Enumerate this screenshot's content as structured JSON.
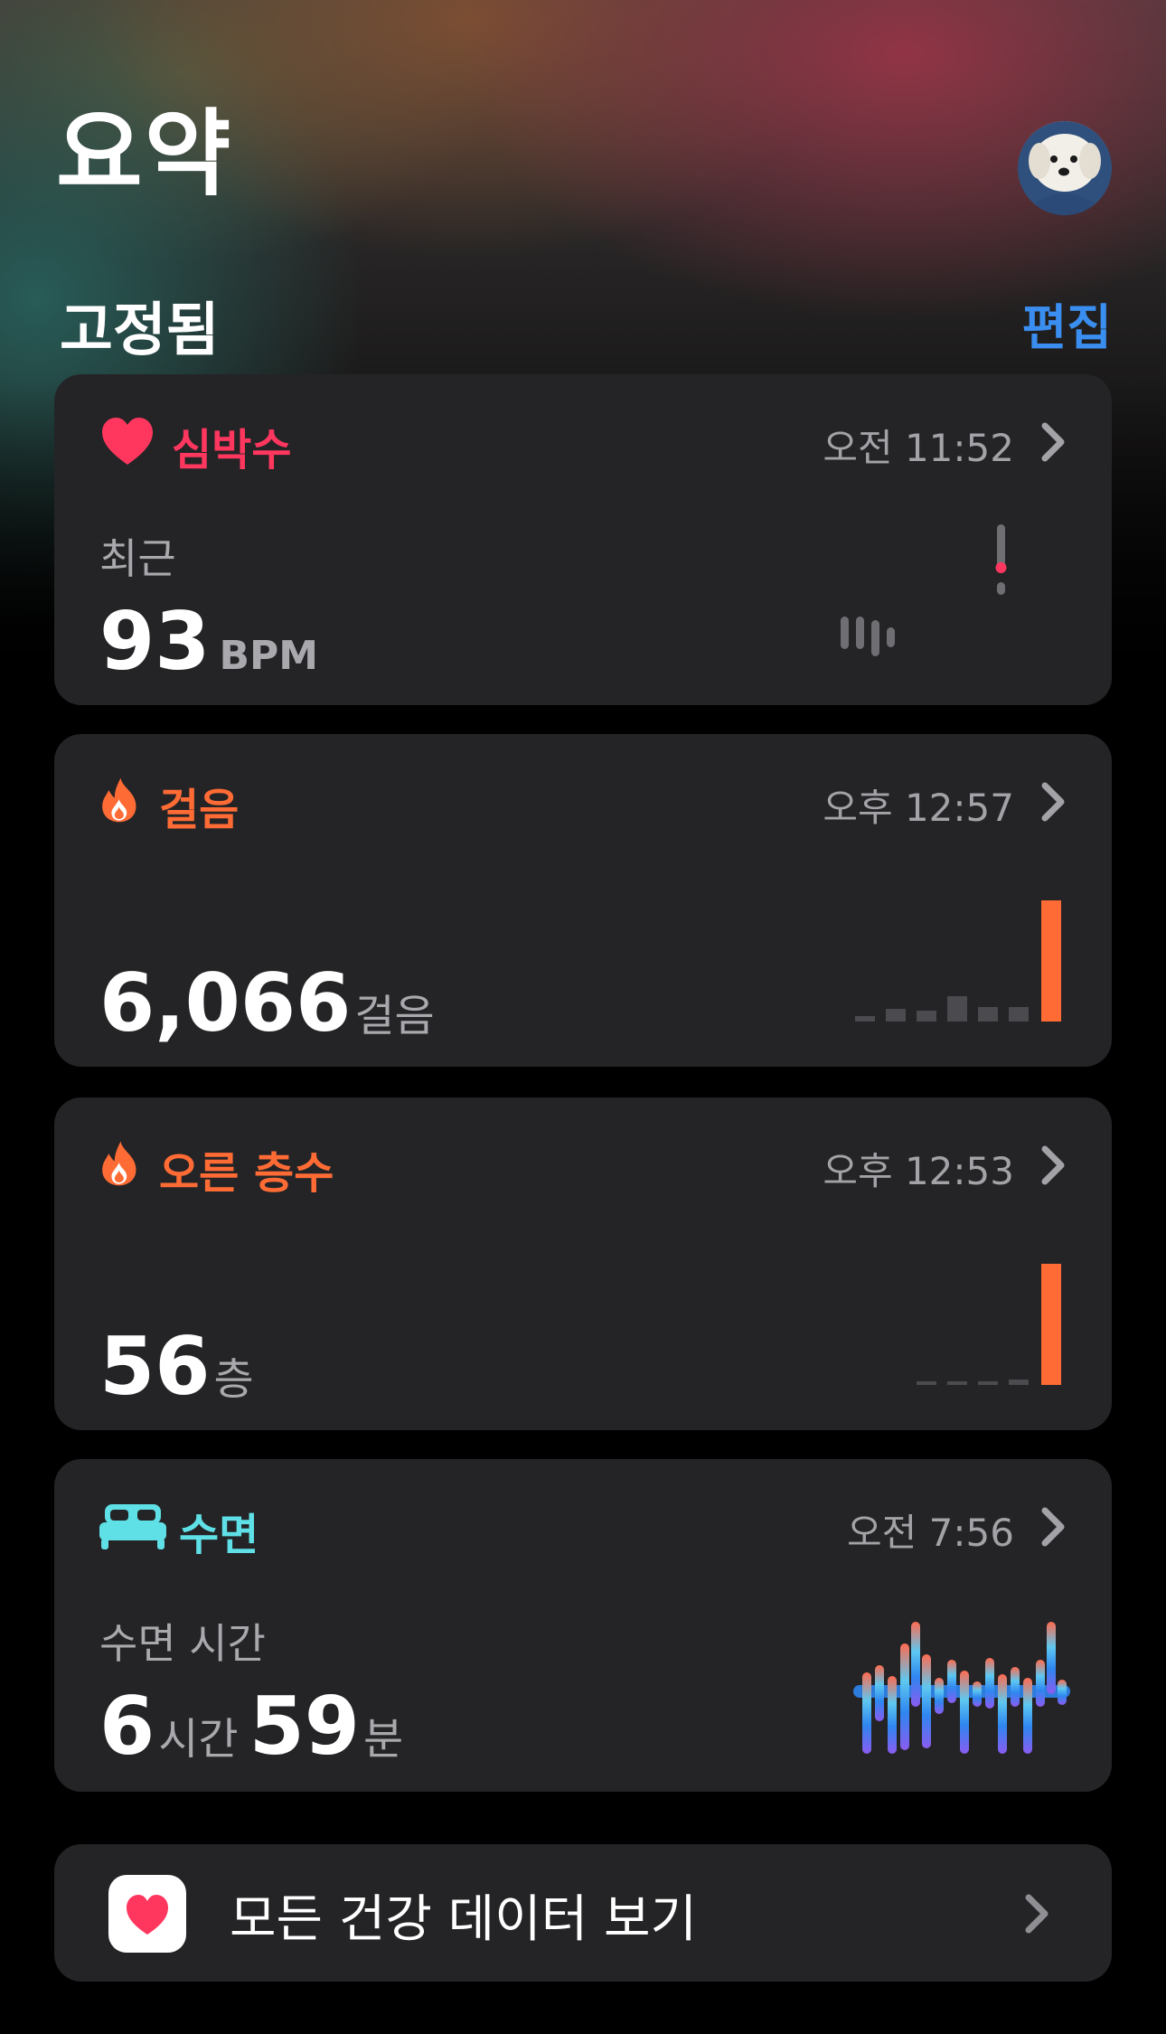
{
  "page": {
    "title": "요약"
  },
  "pinned": {
    "title": "고정됨",
    "edit_label": "편집"
  },
  "colors": {
    "heart": "#ff375f",
    "steps": "#ff6b35",
    "sleep": "#5fe0e6",
    "accent": "#3a8ef0",
    "card": "#242426"
  },
  "cards": {
    "heart_rate": {
      "icon": "heart-icon",
      "title": "심박수",
      "time": "오전 11:52",
      "sub_label": "최근",
      "value": "93",
      "unit": "BPM"
    },
    "steps": {
      "icon": "flame-icon",
      "title": "걸음",
      "time": "오후 12:57",
      "value": "6,066",
      "unit": "걸음"
    },
    "floors": {
      "icon": "flame-icon",
      "title": "오른 층수",
      "time": "오후 12:53",
      "value": "56",
      "unit": "층"
    },
    "sleep": {
      "icon": "bed-icon",
      "title": "수면",
      "time": "오전 7:56",
      "sub_label": "수면 시간",
      "hours": "6",
      "hours_unit": "시간",
      "minutes": "59",
      "minutes_unit": "분"
    }
  },
  "all_data": {
    "icon": "health-app-icon",
    "label": "모든 건강 데이터 보기"
  }
}
